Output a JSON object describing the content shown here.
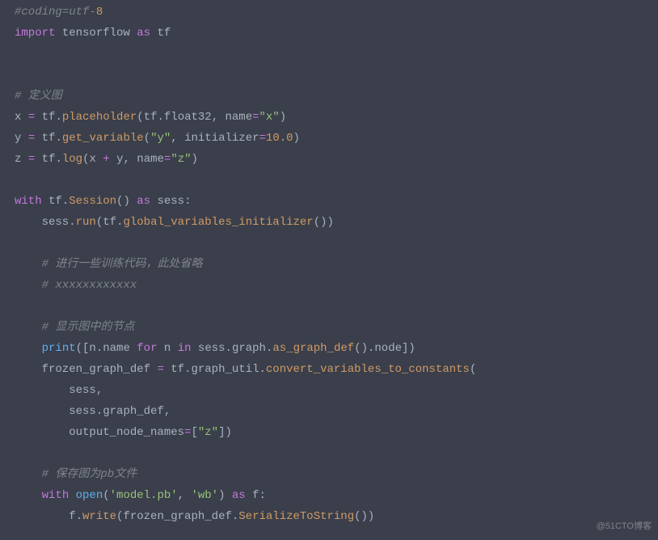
{
  "code": {
    "l1": {
      "a": "#coding",
      "b": "=",
      "c": "utf",
      "d": "-",
      "e": "8"
    },
    "l2": {
      "a": "import",
      "b": " tensorflow ",
      "c": "as",
      "d": " tf"
    },
    "l5": {
      "a": "# 定义图"
    },
    "l6": {
      "a": "x ",
      "b": "=",
      "c": " tf",
      "d": ".",
      "e": "placeholder",
      "f": "(tf",
      "g": ".",
      "h": "float32, name",
      "i": "=",
      "j": "\"x\"",
      "k": ")"
    },
    "l7": {
      "a": "y ",
      "b": "=",
      "c": " tf",
      "d": ".",
      "e": "get_variable",
      "f": "(",
      "g": "\"y\"",
      "h": ", initializer",
      "i": "=",
      "j": "10.0",
      "k": ")"
    },
    "l8": {
      "a": "z ",
      "b": "=",
      "c": " tf",
      "d": ".",
      "e": "log",
      "f": "(x ",
      "g": "+",
      "h": " y, name",
      "i": "=",
      "j": "\"z\"",
      "k": ")"
    },
    "l10": {
      "a": "with",
      "b": " tf",
      "c": ".",
      "d": "Session",
      "e": "() ",
      "f": "as",
      "g": " sess:"
    },
    "l11": {
      "a": "    sess",
      "b": ".",
      "c": "run",
      "d": "(tf",
      "e": ".",
      "f": "global_variables_initializer",
      "g": "())"
    },
    "l13": {
      "a": "    # 进行一些训练代码，此处省略"
    },
    "l14": {
      "a": "    # xxxxxxxxxxxx"
    },
    "l16": {
      "a": "    # 显示图中的节点"
    },
    "l17": {
      "a": "    ",
      "b": "print",
      "c": "([n",
      "d": ".",
      "e": "name ",
      "f": "for",
      "g": " n ",
      "h": "in",
      "i": " sess",
      "j": ".",
      "k": "graph",
      "l": ".",
      "m": "as_graph_def",
      "n": "()",
      "o": ".",
      "p": "node])"
    },
    "l18": {
      "a": "    frozen_graph_def ",
      "b": "=",
      "c": " tf",
      "d": ".",
      "e": "graph_util",
      "f": ".",
      "g": "convert_variables_to_constants",
      "h": "("
    },
    "l19": {
      "a": "        sess,"
    },
    "l20": {
      "a": "        sess",
      "b": ".",
      "c": "graph_def,"
    },
    "l21": {
      "a": "        output_node_names",
      "b": "=",
      "c": "[",
      "d": "\"z\"",
      "e": "])"
    },
    "l23": {
      "a": "    # 保存图为pb文件"
    },
    "l24": {
      "a": "    ",
      "b": "with",
      "c": " ",
      "d": "open",
      "e": "(",
      "f": "'model.pb'",
      "g": ", ",
      "h": "'wb'",
      "i": ") ",
      "j": "as",
      "k": " f:"
    },
    "l25": {
      "a": "        f",
      "b": ".",
      "c": "write",
      "d": "(frozen_graph_def",
      "e": ".",
      "f": "SerializeToString",
      "g": "())"
    }
  },
  "watermark": "@51CTO博客"
}
